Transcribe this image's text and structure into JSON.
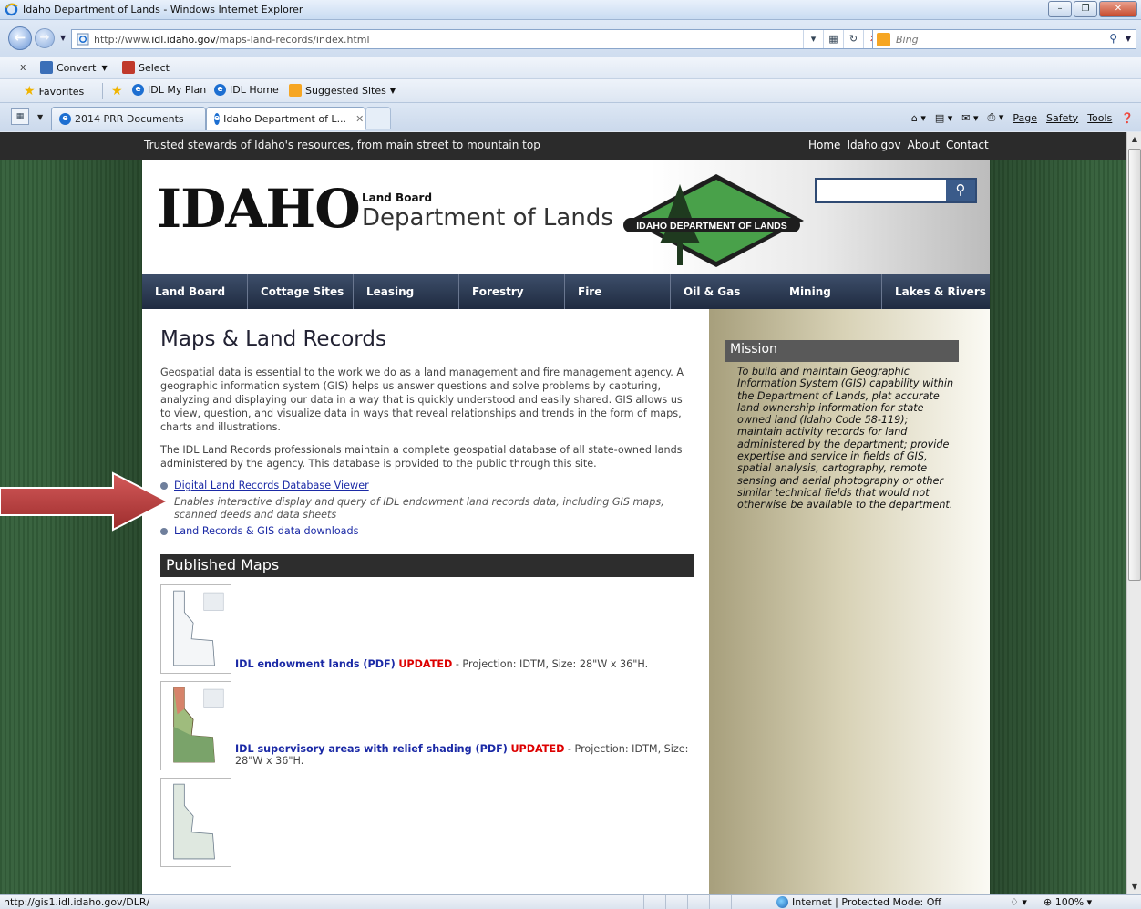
{
  "window": {
    "title": "Idaho Department of Lands - Windows Internet Explorer",
    "buttons": [
      "–",
      "❐",
      "✕"
    ]
  },
  "address": {
    "url_prefix": "http://www.",
    "url_domain": "idl.idaho.gov",
    "url_path": "/maps-land-records/index.html",
    "search_placeholder": "Bing"
  },
  "command_bar": {
    "close": "x",
    "convert": "Convert",
    "select": "Select"
  },
  "favorites_bar": {
    "favorites": "Favorites",
    "items": [
      "IDL My Plan",
      "IDL Home",
      "Suggested Sites"
    ]
  },
  "tabs": [
    {
      "label": "2014 PRR Documents"
    },
    {
      "label": "Idaho Department of L...",
      "active": true
    }
  ],
  "tool_menus": [
    "Page",
    "Safety",
    "Tools"
  ],
  "site": {
    "tagline": "Trusted stewards of Idaho's resources, from main street to mountain top",
    "top_links": [
      "Home",
      "Idaho.gov",
      "About",
      "Contact"
    ],
    "logo_word": "IDAHO",
    "logo_small": "Land Board",
    "logo_dept": "Department of Lands",
    "seal_text": "IDAHO DEPARTMENT OF LANDS",
    "nav": [
      "Land Board",
      "Cottage Sites",
      "Leasing",
      "Forestry",
      "Fire",
      "Oil & Gas",
      "Mining",
      "Lakes & Rivers"
    ]
  },
  "content": {
    "title": "Maps & Land Records",
    "p1": "Geospatial data is essential to the work we do as a land management and fire management agency. A geographic information system (GIS) helps us answer questions and solve problems by capturing, analyzing and displaying our data in a way that is quickly understood and easily shared. GIS allows us to view, question, and visualize data in ways that reveal relationships and trends in the form of maps, charts and illustrations.",
    "p2": "The IDL Land Records professionals maintain a complete geospatial database of all state-owned lands administered by the agency. This database is provided to the public through this site.",
    "link1": "Digital Land Records Database Viewer",
    "link1_desc": "Enables interactive display and query of IDL endowment land records data, including GIS maps, scanned deeds and data sheets",
    "link2": "Land Records & GIS data downloads",
    "published_heading": "Published Maps",
    "maps": [
      {
        "title": "IDL endowment lands (PDF)",
        "updated": "UPDATED",
        "details": " - Projection: IDTM, Size: 28\"W x 36\"H."
      },
      {
        "title": "IDL supervisory areas with relief shading (PDF)",
        "updated": "UPDATED",
        "details": " - Projection: IDTM, Size: 28\"W x 36\"H."
      }
    ]
  },
  "mission": {
    "heading": "Mission",
    "text": "To build and maintain Geographic Information System (GIS) capability within the Department of Lands, plat accurate land ownership information for state owned land (Idaho Code 58-119); maintain activity records for land administered by the department; provide expertise and service in fields of GIS, spatial analysis, cartography, remote sensing and aerial photography or other similar technical fields that would not otherwise be available to the department."
  },
  "status": {
    "url": "http://gis1.idl.idaho.gov/DLR/",
    "zone": "Internet | Protected Mode: Off",
    "zoom": "100%"
  },
  "colors": {
    "link": "#1b2aa6",
    "updated": "#dd0000",
    "nav_bg": "#2a3750",
    "arrow": "#b73a3a"
  }
}
